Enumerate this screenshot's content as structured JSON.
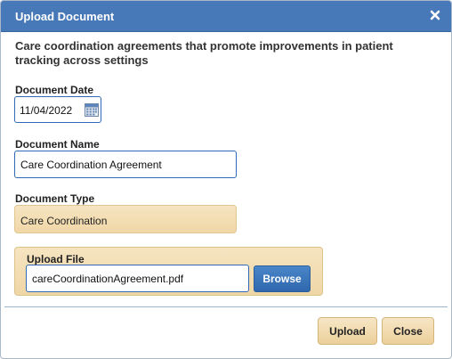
{
  "dialog": {
    "title": "Upload Document",
    "close_icon": "close-x-icon",
    "description": "Care coordination agreements that promote improvements in patient tracking across settings"
  },
  "form": {
    "date_label": "Document Date",
    "date_value": "11/04/2022",
    "calendar_icon": "calendar-icon",
    "name_label": "Document Name",
    "name_value": "Care Coordination Agreement",
    "type_label": "Document Type",
    "type_value": "Care Coordination",
    "upload_label": "Upload File",
    "file_value": "careCoordinationAgreement.pdf",
    "browse_label": "Browse"
  },
  "footer": {
    "upload_label": "Upload",
    "close_label": "Close"
  },
  "colors": {
    "titlebar": "#4779b8",
    "input_border": "#2e6ab5",
    "panel_tan": "#f3ddb3",
    "browse_blue": "#2f67ad"
  }
}
